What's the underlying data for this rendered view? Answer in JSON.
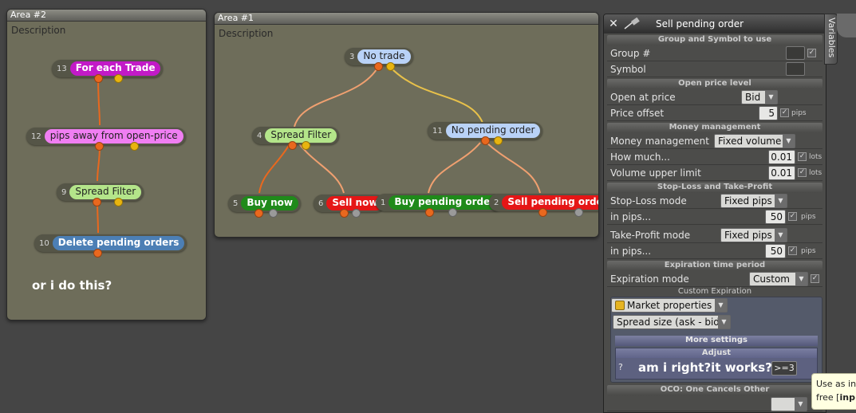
{
  "area2": {
    "title": "Area #2",
    "description": "Description",
    "note": "or i do this?",
    "blocks": [
      {
        "id": "13",
        "label": "For each Trade"
      },
      {
        "id": "12",
        "label": "pips away from open-price"
      },
      {
        "id": "9",
        "label": "Spread Filter"
      },
      {
        "id": "10",
        "label": "Delete pending orders"
      }
    ]
  },
  "area1": {
    "title": "Area #1",
    "description": "Description",
    "blocks": [
      {
        "id": "3",
        "label": "No trade"
      },
      {
        "id": "4",
        "label": "Spread Filter"
      },
      {
        "id": "11",
        "label": "No pending order"
      },
      {
        "id": "5",
        "label": "Buy now"
      },
      {
        "id": "6",
        "label": "Sell now"
      },
      {
        "id": "1",
        "label": "Buy pending order"
      },
      {
        "id": "2",
        "label": "Sell pending order"
      }
    ]
  },
  "panel": {
    "title": "Sell pending order",
    "sections": {
      "group_symbol": "Group and Symbol to use",
      "open_price": "Open price level",
      "money": "Money management",
      "sltp": "Stop-Loss and Take-Profit",
      "expiration": "Expiration time period",
      "oco": "OCO: One Cancels Other"
    },
    "group_label": "Group #",
    "symbol_label": "Symbol",
    "open_at_price_label": "Open at price",
    "open_at_price_value": "Bid",
    "price_offset_label": "Price offset",
    "price_offset_value": "5",
    "unit_pips": "pips",
    "unit_lots": "lots",
    "money_mgmt_label": "Money management",
    "money_mgmt_value": "Fixed volume",
    "how_much_label": "How much...",
    "how_much_value": "0.01",
    "vol_upper_label": "Volume upper limit",
    "vol_upper_value": "0.01",
    "sl_mode_label": "Stop-Loss mode",
    "sl_mode_value": "Fixed pips",
    "sl_pips_label": "in pips...",
    "sl_pips_value": "50",
    "tp_mode_label": "Take-Profit mode",
    "tp_mode_value": "Fixed pips",
    "tp_pips_label": "in pips...",
    "tp_pips_value": "50",
    "exp_mode_label": "Expiration mode",
    "exp_mode_value": "Custom",
    "custom_exp_label": "Custom Expiration",
    "market_props_value": "Market properties",
    "spread_size_value": "Spread size (ask - bid)",
    "more_settings_label": "More settings",
    "adjust_label": "Adjust",
    "question_mark": "?",
    "operator_value": ">=3",
    "overlay_note": "am i right?it works?"
  },
  "variables_tab": "Variables",
  "tooltip": {
    "line1": "Use as in",
    "line2_prefix": "free [",
    "line2_bold": "inp"
  },
  "colors": {
    "link_orange": "#e9681e",
    "link_yellow": "#e8b40f",
    "block_magenta": "#c21ac7",
    "block_green": "#1f8a1a",
    "block_red": "#e51616"
  }
}
